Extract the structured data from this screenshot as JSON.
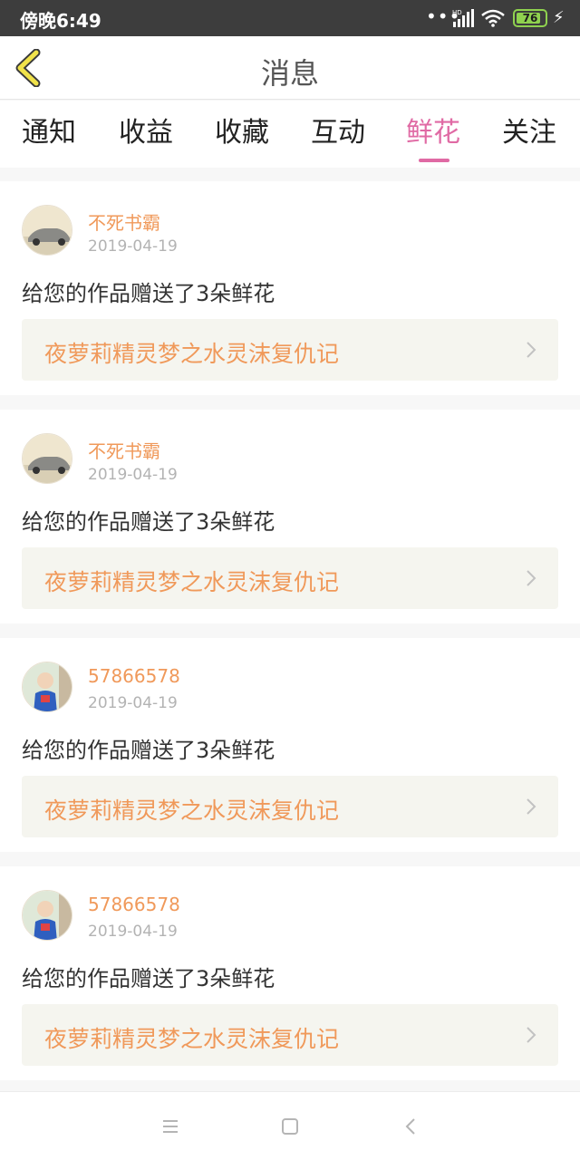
{
  "status_bar": {
    "time": "傍晚6:49",
    "battery": "76",
    "hd_label": "HD"
  },
  "header": {
    "title": "消息",
    "back_icon": "back-chevron-icon"
  },
  "tabs": [
    {
      "label": "通知"
    },
    {
      "label": "收益"
    },
    {
      "label": "收藏"
    },
    {
      "label": "互动"
    },
    {
      "label": "鲜花",
      "active": true
    },
    {
      "label": "关注"
    }
  ],
  "colors": {
    "accent": "#e06aa4",
    "name": "#f0995a",
    "date": "#b3b3b3",
    "work_bg": "#f5f5ef"
  },
  "messages": [
    {
      "user": "不死书霸",
      "date": "2019-04-19",
      "text": "给您的作品赠送了3朵鲜花",
      "work": "夜萝莉精灵梦之水灵沫复仇记",
      "avatar": "car-avatar"
    },
    {
      "user": "不死书霸",
      "date": "2019-04-19",
      "text": "给您的作品赠送了3朵鲜花",
      "work": "夜萝莉精灵梦之水灵沫复仇记",
      "avatar": "car-avatar"
    },
    {
      "user": "57866578",
      "date": "2019-04-19",
      "text": "给您的作品赠送了3朵鲜花",
      "work": "夜萝莉精灵梦之水灵沫复仇记",
      "avatar": "child-avatar"
    },
    {
      "user": "57866578",
      "date": "2019-04-19",
      "text": "给您的作品赠送了3朵鲜花",
      "work": "夜萝莉精灵梦之水灵沫复仇记",
      "avatar": "child-avatar"
    }
  ],
  "nav_bar": {
    "icons": [
      "menu-icon",
      "home-square-icon",
      "back-triangle-icon"
    ]
  }
}
